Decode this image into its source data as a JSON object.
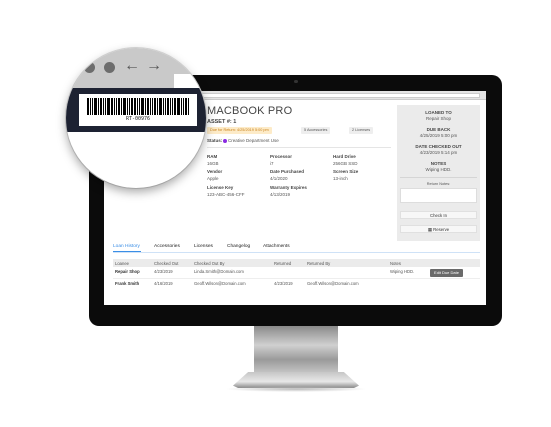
{
  "asset": {
    "title": "MACBOOK PRO",
    "asset_number": "ASSET #: 1",
    "due_badge": "Due for Return: 4/25/2019 5:00 pm",
    "accessories_badge": "5 Accessories",
    "licenses_badge": "2 Licenses",
    "status_label": "Status:",
    "status_value": "Creative Department Use",
    "status_color": "#8a2be2",
    "fields": [
      {
        "label": "RAM",
        "value": "16GB"
      },
      {
        "label": "Processor",
        "value": "i7"
      },
      {
        "label": "Hard Drive",
        "value": "256GB SSD"
      },
      {
        "label": "Vendor",
        "value": "Apple"
      },
      {
        "label": "Date Purchased",
        "value": "4/1/2020"
      },
      {
        "label": "Screen Size",
        "value": "13-inch"
      },
      {
        "label": "License Key",
        "value": "123-ABC-456-CFF"
      },
      {
        "label": "Warranty Expires",
        "value": "4/13/2019"
      }
    ]
  },
  "sidebar": {
    "loaned_to_label": "LOANED TO",
    "loaned_to": "Repair Shop",
    "due_back_label": "DUE BACK",
    "due_back": "4/25/2019 5:00 pm",
    "checked_out_label": "DATE CHECKED OUT",
    "checked_out": "4/23/2019 5:14 pm",
    "notes_label": "NOTES",
    "notes": "Wiping HDD.",
    "return_notes_label": "Return Notes:",
    "checkin_label": "Check In",
    "reserve_label": "Reserve"
  },
  "tabs": [
    "Loan History",
    "Accessories",
    "Licenses",
    "Changelog",
    "Attachments"
  ],
  "table": {
    "headers": [
      "Loanee",
      "Checked Out",
      "Checked Out By",
      "Returned",
      "Returned By",
      "Notes"
    ],
    "rows": [
      [
        "Repair Shop",
        "4/23/2019",
        "Linda.Smith@Domain.com",
        "",
        "",
        "Wiping HDD."
      ],
      [
        "Frank Smith",
        "4/16/2019",
        "Geoff.Wilson@Domain.com",
        "4/23/2019",
        "Geoff.Wilson@Domain.com",
        ""
      ]
    ],
    "edit_label": "Edit Due Date"
  },
  "magnifier": {
    "barcode_text": "RT-00976"
  },
  "colors": {
    "accent": "#3a8ee6",
    "due_badge_bg": "#fdebc8",
    "due_badge_text": "#c8801a"
  }
}
